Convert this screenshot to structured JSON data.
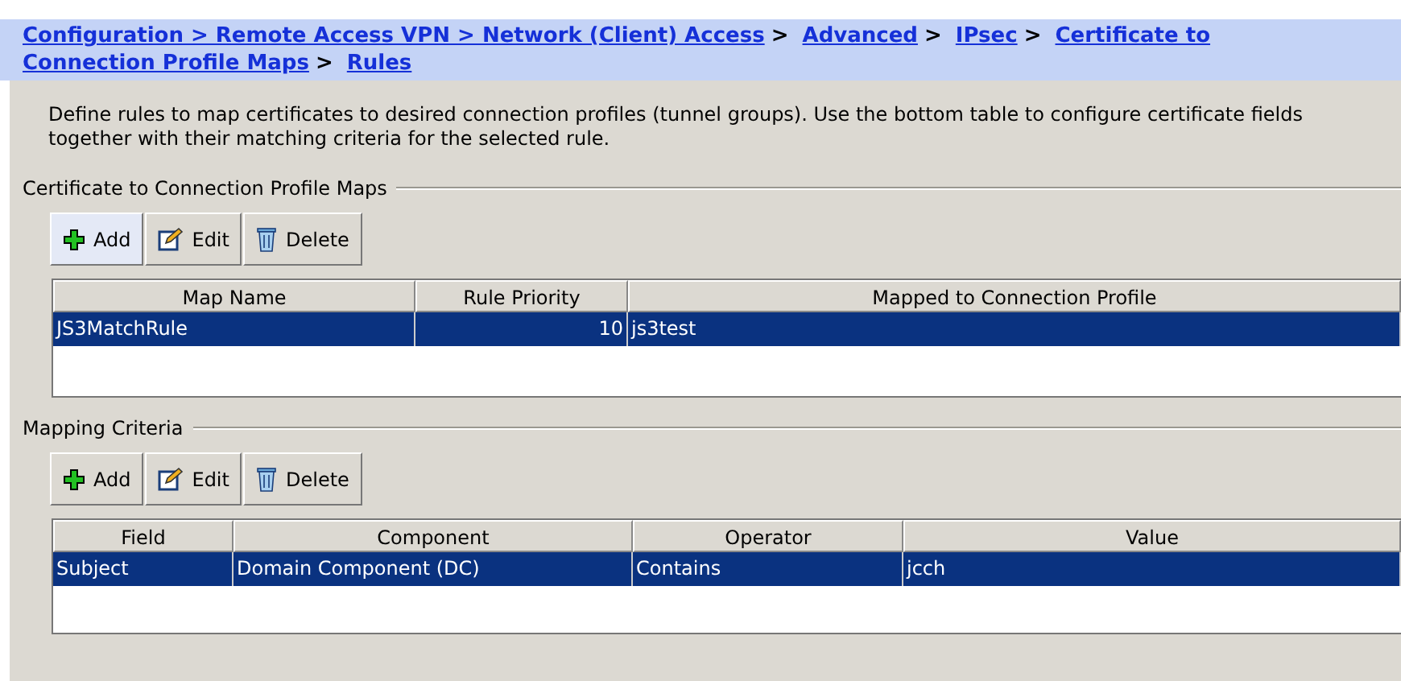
{
  "breadcrumb": {
    "separator": ">",
    "items": [
      {
        "text": "Configuration > Remote Access VPN > Network (Client) Access"
      },
      {
        "text": "Advanced"
      },
      {
        "text": "IPsec"
      },
      {
        "lines": [
          "Certificate to",
          "Connection Profile Maps"
        ]
      },
      {
        "text": "Rules"
      }
    ]
  },
  "description": "Define rules to map certificates to desired connection profiles (tunnel groups). Use the bottom table to configure certificate fields together with their matching criteria for the selected rule.",
  "sections": [
    {
      "title": "Certificate to Connection Profile Maps",
      "toolbar": [
        {
          "kind": "add",
          "label": "Add",
          "highlighted": true
        },
        {
          "kind": "edit",
          "label": "Edit",
          "highlighted": false
        },
        {
          "kind": "delete",
          "label": "Delete",
          "highlighted": false
        }
      ],
      "table": {
        "columns": [
          "Map Name",
          "Rule Priority",
          "Mapped to Connection Profile"
        ],
        "rows": [
          {
            "selected": true,
            "cells": [
              {
                "text": "JS3MatchRule",
                "numeric": false
              },
              {
                "text": "10",
                "numeric": true
              },
              {
                "text": "js3test",
                "numeric": false
              }
            ]
          }
        ]
      }
    },
    {
      "title": "Mapping Criteria",
      "toolbar": [
        {
          "kind": "add",
          "label": "Add",
          "highlighted": false
        },
        {
          "kind": "edit",
          "label": "Edit",
          "highlighted": false
        },
        {
          "kind": "delete",
          "label": "Delete",
          "highlighted": false
        }
      ],
      "table": {
        "columns": [
          "Field",
          "Component",
          "Operator",
          "Value"
        ],
        "rows": [
          {
            "selected": true,
            "cells": [
              {
                "text": "Subject",
                "numeric": false
              },
              {
                "text": "Domain Component (DC)",
                "numeric": false
              },
              {
                "text": "Contains",
                "numeric": false
              },
              {
                "text": "jcch",
                "numeric": false
              }
            ]
          }
        ]
      }
    }
  ]
}
